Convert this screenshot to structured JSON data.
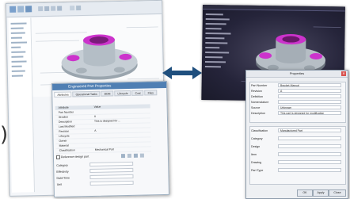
{
  "left_fragment": {
    "text": ")"
  },
  "left_dialog": {
    "title": "Engineered Part Properties",
    "tabs": [
      "Attributes",
      "Operational Tasks",
      "BOM",
      "Lifecycle",
      "Cost",
      "Files"
    ],
    "grid_header": [
      "Attribute",
      "Value"
    ],
    "rows": [
      {
        "key": "Part Number",
        "value": ""
      },
      {
        "key": "Iteration",
        "value": "A"
      },
      {
        "key": "Description",
        "value": "This is designed for ..."
      },
      {
        "key": "Last Modified",
        "value": ""
      },
      {
        "key": "Revision",
        "value": "A"
      },
      {
        "key": "Lifecycle",
        "value": ""
      },
      {
        "key": "Owner",
        "value": ""
      },
      {
        "key": "Material",
        "value": ""
      },
      {
        "key": "Classification",
        "value": "Mechanical Part"
      }
    ],
    "checkbox_label": "Reference design part",
    "fields": [
      {
        "label": "Category",
        "value": ""
      },
      {
        "label": "Effectivity",
        "value": ""
      },
      {
        "label": "Date/Time",
        "value": ""
      },
      {
        "label": "Unit",
        "value": ""
      }
    ]
  },
  "right_dialog": {
    "title": "Properties",
    "section1": [
      {
        "label": "Part Number",
        "value": "Bracket-Manual"
      },
      {
        "label": "Revision",
        "value": "A"
      },
      {
        "label": "Definition",
        "value": ""
      },
      {
        "label": "Nomenclature",
        "value": ""
      },
      {
        "label": "Source",
        "value": "Unknown"
      },
      {
        "label": "Description",
        "value": "This part is designed for modification"
      }
    ],
    "section2": [
      {
        "label": "Classification",
        "value": "Manufactured Part"
      },
      {
        "label": "Category",
        "value": ""
      },
      {
        "label": "Design",
        "value": ""
      },
      {
        "label": "Item",
        "value": ""
      },
      {
        "label": "Drawing",
        "value": ""
      },
      {
        "label": "Part Type",
        "value": ""
      }
    ],
    "buttons": [
      "OK",
      "Apply",
      "Close"
    ]
  },
  "colors": {
    "accent": "#4f7fb3",
    "arrow": "#1f4f7e",
    "model_body": "#b9c2c9",
    "model_highlight": "#cc33cc",
    "dark_bg": "#25243a"
  }
}
